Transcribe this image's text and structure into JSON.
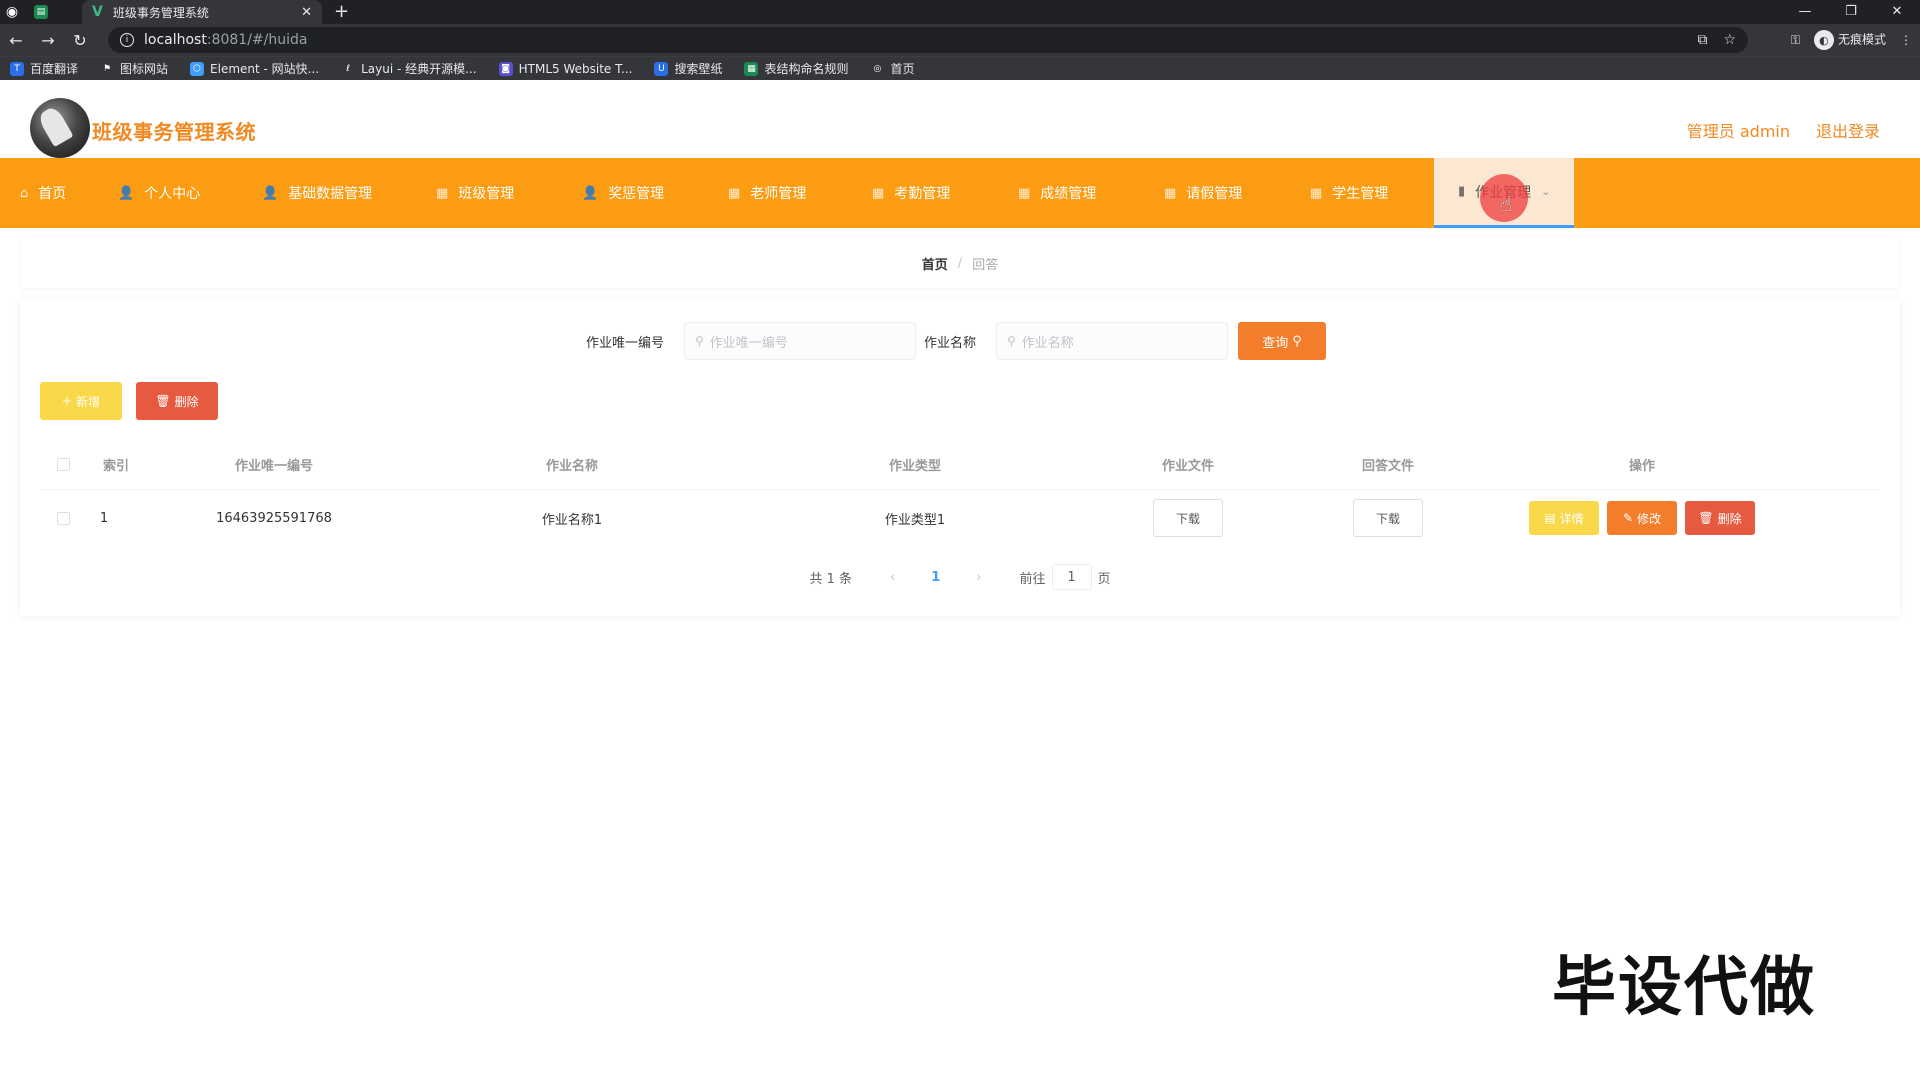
{
  "browser": {
    "tab_title": "班级事务管理系统",
    "tab_close": "✕",
    "new_tab": "+",
    "url_host": "localhost",
    "url_rest": ":8081/#/huida",
    "incognito_label": "无痕模式",
    "bookmarks": [
      {
        "label": "百度翻译",
        "icon": "translate-icon",
        "color": "#2a6ee8"
      },
      {
        "label": "图标网站",
        "icon": "flag-icon",
        "color": "#35363a"
      },
      {
        "label": "Element - 网站快...",
        "icon": "element-icon",
        "color": "#409eff"
      },
      {
        "label": "Layui - 经典开源模...",
        "icon": "layui-icon",
        "color": "#35363a"
      },
      {
        "label": "HTML5 Website T...",
        "icon": "html5-icon",
        "color": "#5a4fcf"
      },
      {
        "label": "搜索壁纸",
        "icon": "wallpaper-icon",
        "color": "#2a6ee8"
      },
      {
        "label": "表结构命名规则",
        "icon": "sheet-icon",
        "color": "#1a8a52"
      },
      {
        "label": "首页",
        "icon": "globe-icon",
        "color": "#35363a"
      }
    ]
  },
  "header": {
    "app_title": "班级事务管理系统",
    "user_label": "管理员 admin",
    "logout": "退出登录"
  },
  "menu": [
    {
      "label": "首页",
      "icon": "home-icon"
    },
    {
      "label": "个人中心",
      "icon": "user-icon"
    },
    {
      "label": "基础数据管理",
      "icon": "user-icon"
    },
    {
      "label": "班级管理",
      "icon": "menu-icon"
    },
    {
      "label": "奖惩管理",
      "icon": "user-icon"
    },
    {
      "label": "老师管理",
      "icon": "menu-icon"
    },
    {
      "label": "考勤管理",
      "icon": "menu-icon"
    },
    {
      "label": "成绩管理",
      "icon": "menu-icon"
    },
    {
      "label": "请假管理",
      "icon": "menu-icon"
    },
    {
      "label": "学生管理",
      "icon": "menu-icon"
    },
    {
      "label": "作业管理",
      "icon": "chart-icon",
      "active": true
    }
  ],
  "breadcrumb": {
    "home": "首页",
    "separator": "/",
    "current": "回答"
  },
  "search": {
    "field1_label": "作业唯一编号",
    "field1_placeholder": "作业唯一编号",
    "field2_label": "作业名称",
    "field2_placeholder": "作业名称",
    "query_label": "查询"
  },
  "actions": {
    "add_label": "新增",
    "delete_label": "删除"
  },
  "table": {
    "columns": [
      "索引",
      "作业唯一编号",
      "作业名称",
      "作业类型",
      "作业文件",
      "回答文件",
      "操作"
    ],
    "rows": [
      {
        "index": "1",
        "code": "16463925591768",
        "name": "作业名称1",
        "type": "作业类型1",
        "file_btn": "下载",
        "answer_btn": "下载",
        "detail": "详情",
        "edit": "修改",
        "delete": "删除"
      }
    ]
  },
  "pagination": {
    "total": "共 1 条",
    "prev": "‹",
    "page": "1",
    "next": "›",
    "goto": "前往",
    "goto_value": "1",
    "unit": "页"
  },
  "watermark": "毕设代做",
  "colors": {
    "accent": "#fb9c12",
    "title": "#f08a24",
    "warning": "#f9d84a",
    "danger": "#e65a3f"
  }
}
